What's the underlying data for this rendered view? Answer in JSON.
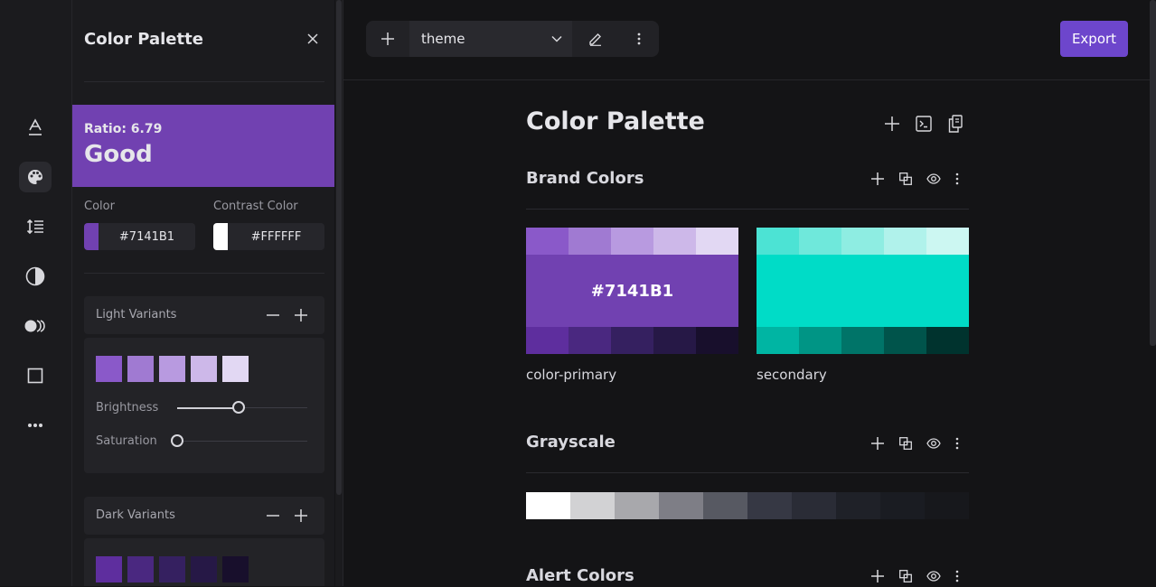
{
  "rail": {
    "items": [
      {
        "name": "typography-icon",
        "glyph": "A"
      },
      {
        "name": "palette-icon",
        "glyph": "palette",
        "active": true
      },
      {
        "name": "line-height-icon",
        "glyph": "lines"
      },
      {
        "name": "contrast-icon",
        "glyph": "contrast"
      },
      {
        "name": "opacity-icon",
        "glyph": "dots"
      },
      {
        "name": "square-icon",
        "glyph": "square"
      },
      {
        "name": "more-icon",
        "glyph": "..."
      }
    ]
  },
  "panel": {
    "title": "Color Palette",
    "preview": {
      "ratio": "Ratio: 6.79",
      "grade": "Good",
      "bg": "#7141B1"
    },
    "color_label": "Color",
    "contrast_label": "Contrast Color",
    "color_value": "#7141B1",
    "contrast_value": "#FFFFFF",
    "light_variants": {
      "title": "Light Variants",
      "chips": [
        "#8A59C9",
        "#A07AD2",
        "#B89AE0",
        "#CDB8E9",
        "#E2D8F3"
      ],
      "brightness_label": "Brightness",
      "saturation_label": "Saturation",
      "brightness_value": 0.47,
      "saturation_value": 0.0
    },
    "dark_variants": {
      "title": "Dark Variants",
      "chips": [
        "#5E2E9E",
        "#4A2880",
        "#352060",
        "#261846",
        "#180F2C"
      ]
    }
  },
  "toolbar": {
    "theme_value": "theme",
    "export_label": "Export"
  },
  "page": {
    "title": "Color Palette",
    "groups": {
      "brand": {
        "title": "Brand Colors"
      },
      "grayscale": {
        "title": "Grayscale"
      },
      "alert": {
        "title": "Alert Colors"
      }
    },
    "brand_swatches": [
      {
        "name": "color-primary",
        "hex_label": "#7141B1",
        "main": "#7141B1",
        "light": [
          "#8A59C9",
          "#A07AD2",
          "#B89AE0",
          "#CDB8E9",
          "#E2D8F3"
        ],
        "dark": [
          "#5E2E9E",
          "#4A2880",
          "#352060",
          "#261846",
          "#180F2C"
        ]
      },
      {
        "name": "secondary",
        "hex_label": "",
        "main": "#00DCC7",
        "light": [
          "#4CE3D4",
          "#6FE8DB",
          "#8EEDE2",
          "#B0F2EB",
          "#CCF7F2"
        ],
        "dark": [
          "#00B5A3",
          "#009585",
          "#007468",
          "#00544B",
          "#00332E"
        ]
      }
    ],
    "grayscale": [
      "#FFFFFF",
      "#D2D2D4",
      "#A8A8AC",
      "#7E7E86",
      "#575962",
      "#363844",
      "#2A2C36",
      "#1F2128",
      "#1A1C22",
      "#17181C"
    ]
  }
}
